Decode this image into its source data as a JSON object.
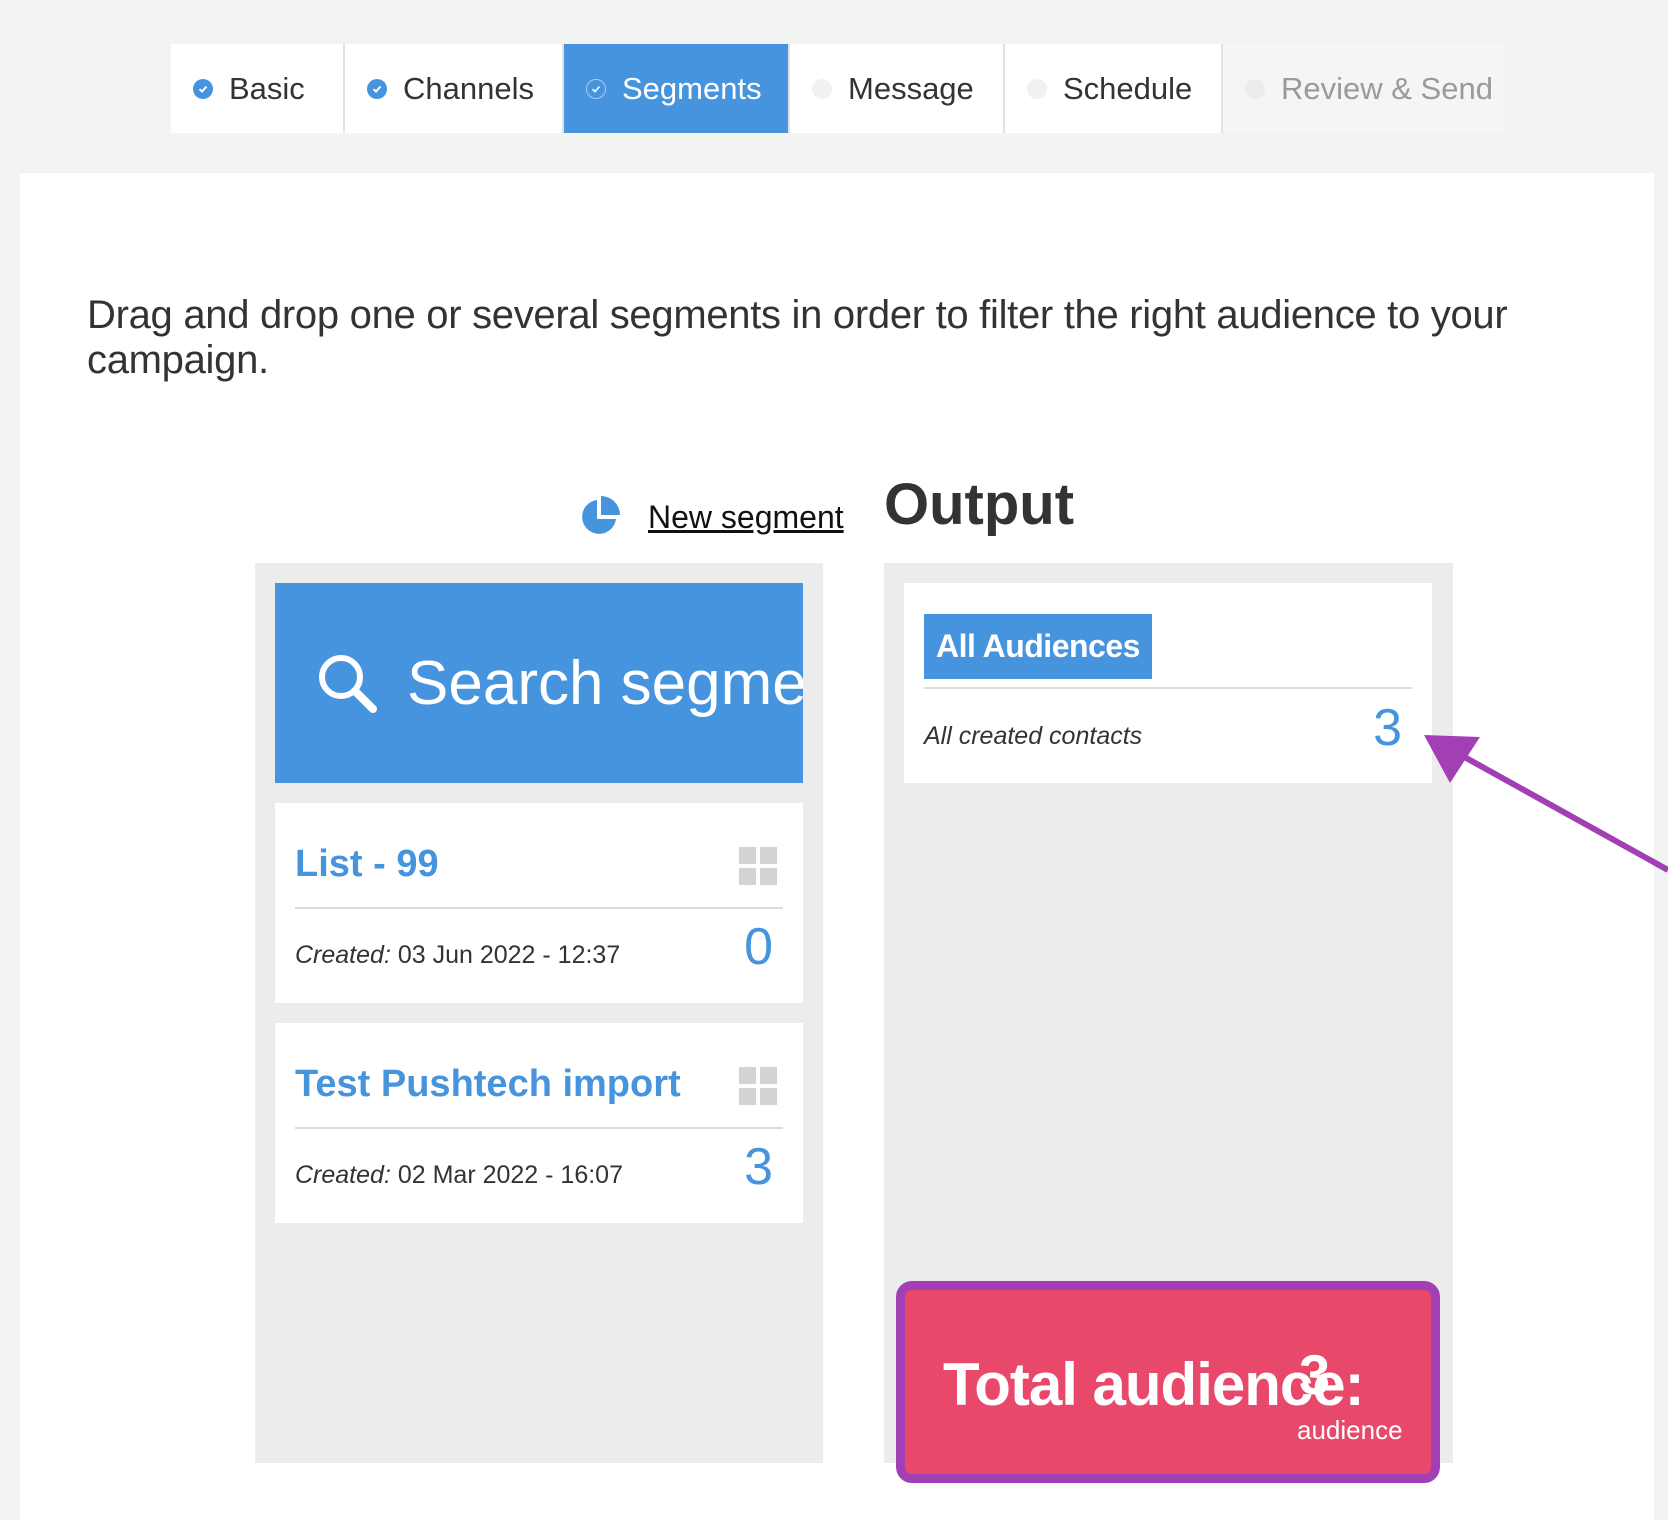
{
  "wizard": {
    "tabs": [
      {
        "label": "Basic",
        "state": "done"
      },
      {
        "label": "Channels",
        "state": "done"
      },
      {
        "label": "Segments",
        "state": "active"
      },
      {
        "label": "Message",
        "state": "todo"
      },
      {
        "label": "Schedule",
        "state": "todo"
      },
      {
        "label": "Review & Send",
        "state": "disabled"
      }
    ]
  },
  "main": {
    "instructions": "Drag and drop one or several segments in order to filter the right audience to your campaign.",
    "new_segment_label": "New segment",
    "output_title": "Output",
    "search_placeholder": "Search segmen"
  },
  "segments": [
    {
      "name": "List - 99",
      "created_label": "Created:",
      "created_value": " 03 Jun 2022 - 12:37",
      "count": "0"
    },
    {
      "name": "Test Pushtech import",
      "created_label": "Created:",
      "created_value": " 02 Mar 2022 - 16:07",
      "count": "3"
    }
  ],
  "output": {
    "audience_badge": "All Audiences",
    "audience_desc": "All created contacts",
    "audience_count": "3",
    "total_label": "Total audience:",
    "total_value": "3",
    "total_unit": "audience"
  },
  "colors": {
    "accent": "#4694de",
    "total_bg": "#e8486a",
    "annotation": "#a33fb4"
  },
  "icons": {
    "tab_status": "check-circle-icon",
    "new_segment": "pie-chart-icon",
    "search": "search-icon",
    "segment_handle": "grid-icon",
    "annotation": "arrow-icon"
  }
}
